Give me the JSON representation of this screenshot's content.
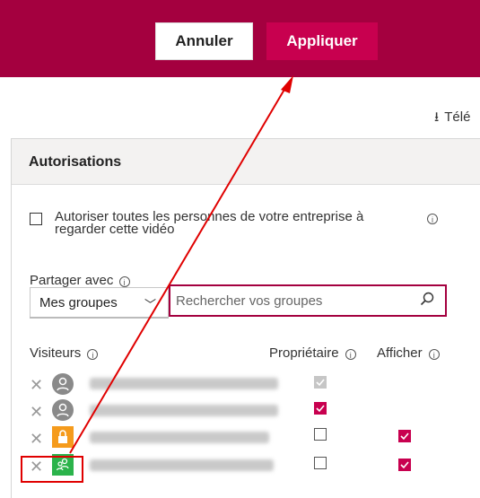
{
  "toolbar": {
    "cancel_label": "Annuler",
    "apply_label": "Appliquer"
  },
  "download_label": "Télé",
  "permissions": {
    "title": "Autorisations",
    "allow_all_text": "Autoriser toutes les personnes de votre entreprise à regarder cette vidéo",
    "share_with_label": "Partager avec",
    "group_dropdown_value": "Mes groupes",
    "search_placeholder": "Rechercher vos groupes",
    "columns": {
      "visitors": "Visiteurs",
      "owner": "Propriétaire",
      "display": "Afficher"
    },
    "rows": [
      {
        "icon": "person-icon",
        "owner_checked": true,
        "owner_disabled": true,
        "display_checked": false
      },
      {
        "icon": "person-icon",
        "owner_checked": true,
        "owner_disabled": false,
        "display_checked": false
      },
      {
        "icon": "lock-group-icon",
        "owner_checked": false,
        "owner_disabled": false,
        "display_checked": true
      },
      {
        "icon": "group-icon",
        "owner_checked": false,
        "owner_disabled": false,
        "display_checked": true
      }
    ]
  },
  "colors": {
    "brand": "#a4003f",
    "accent": "#c8004f",
    "highlight": "#e00000"
  }
}
